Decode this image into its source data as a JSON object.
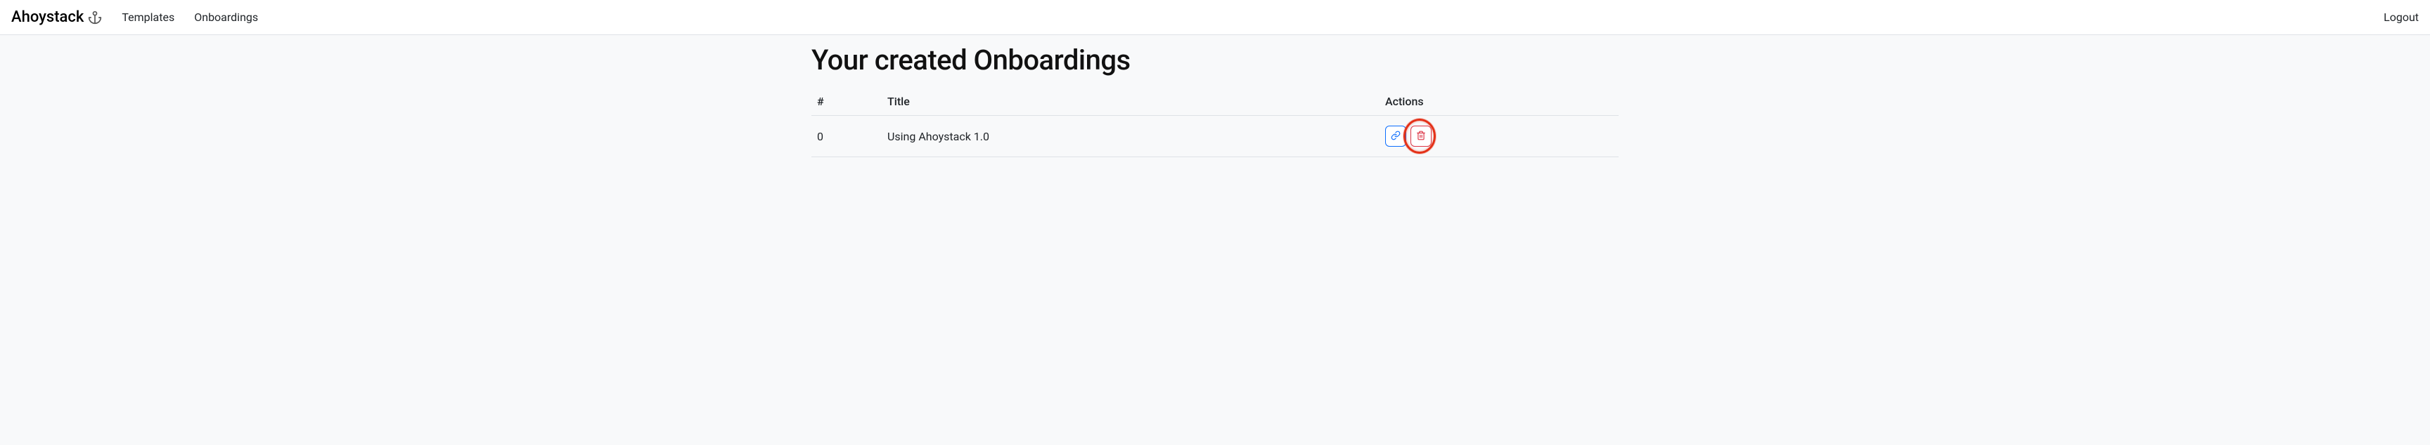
{
  "brand": {
    "name": "Ahoystack",
    "icon": "anchor-icon"
  },
  "nav": {
    "templates": "Templates",
    "onboardings": "Onboardings",
    "logout": "Logout"
  },
  "page": {
    "title": "Your created Onboardings"
  },
  "table": {
    "headers": {
      "index": "#",
      "title": "Title",
      "actions": "Actions"
    },
    "rows": [
      {
        "index": "0",
        "title": "Using Ahoystack 1.0"
      }
    ]
  }
}
